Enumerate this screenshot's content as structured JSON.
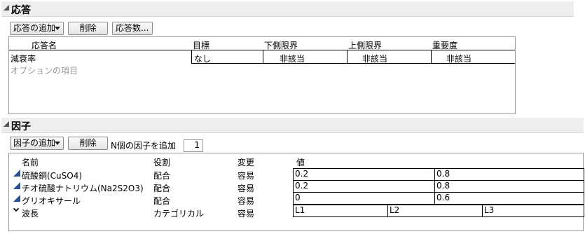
{
  "responses": {
    "title": "応答",
    "add_button": "応答の追加",
    "delete_button": "削除",
    "count_button": "応答数...",
    "columns": [
      "応答名",
      "目標",
      "下側限界",
      "上側限界",
      "重要度"
    ],
    "row": {
      "name": "減衰率",
      "goal": "なし",
      "lower": "非該当",
      "upper": "非該当",
      "importance": "非該当"
    },
    "optional_label": "オプションの項目"
  },
  "factors": {
    "title": "因子",
    "add_button": "因子の追加",
    "delete_button": "削除",
    "add_n_label": "N個の因子を追加",
    "add_n_value": "1",
    "columns": [
      "名前",
      "役割",
      "変更",
      "値"
    ],
    "rows": [
      {
        "name": "硫酸銅(CuSO4)",
        "role": "配合",
        "change": "容易",
        "values": [
          "0.2",
          "0.8"
        ]
      },
      {
        "name": "チオ硫酸ナトリウム(Na2S2O3)",
        "role": "配合",
        "change": "容易",
        "values": [
          "0.2",
          "0.8"
        ]
      },
      {
        "name": "グリオキサール",
        "role": "配合",
        "change": "容易",
        "values": [
          "0",
          "0.6"
        ]
      },
      {
        "name": "波長",
        "role": "カテゴリカル",
        "change": "容易",
        "values": [
          "L1",
          "L2",
          "L3"
        ]
      }
    ]
  },
  "colors": {
    "header_bg": "#eeeeee",
    "factor_icon": "#2a4f8f"
  }
}
